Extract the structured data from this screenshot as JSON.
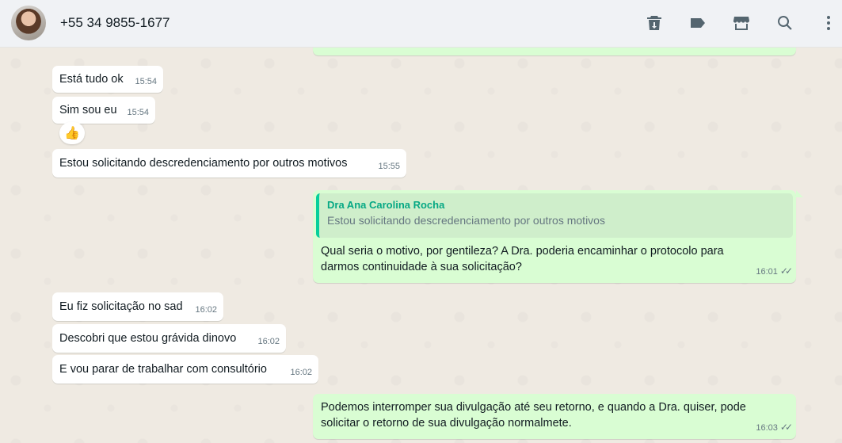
{
  "header": {
    "contact_name": "+55 34 9855-1677",
    "icons": [
      "delete-icon",
      "label-icon",
      "store-icon",
      "search-icon",
      "menu-icon"
    ]
  },
  "messages": [
    {
      "dir": "in",
      "text": "Está tudo ok",
      "time": "15:54"
    },
    {
      "dir": "in",
      "text": "Sim sou eu",
      "time": "15:54",
      "reaction": "👍"
    },
    {
      "dir": "in",
      "text": "Estou solicitando descredenciamento por outros motivos",
      "time": "15:55"
    },
    {
      "dir": "out",
      "quote_author": "Dra Ana Carolina Rocha",
      "quote_text": "Estou solicitando descredenciamento por outros motivos",
      "line1": "Qual seria o motivo, por gentileza?  A Dra. poderia encaminhar o protocolo para",
      "line2": "darmos continuidade à sua solicitação?",
      "time": "16:01"
    },
    {
      "dir": "in",
      "text": "Eu fiz solicitação no sad",
      "time": "16:02"
    },
    {
      "dir": "in",
      "text": "Descobri que estou grávida dinovo",
      "time": "16:02"
    },
    {
      "dir": "in",
      "text": "E vou parar de trabalhar com consultório",
      "time": "16:02"
    },
    {
      "dir": "out",
      "line1": "Podemos interromper sua divulgação até seu retorno, e quando a Dra. quiser, pode",
      "line2": "solicitar o retorno de sua divulgação normalmete.",
      "time": "16:03"
    }
  ],
  "colors": {
    "incoming": "#ffffff",
    "outgoing": "#d9fdd3",
    "background": "#efeae2",
    "quote_accent": "#06cf9c"
  }
}
